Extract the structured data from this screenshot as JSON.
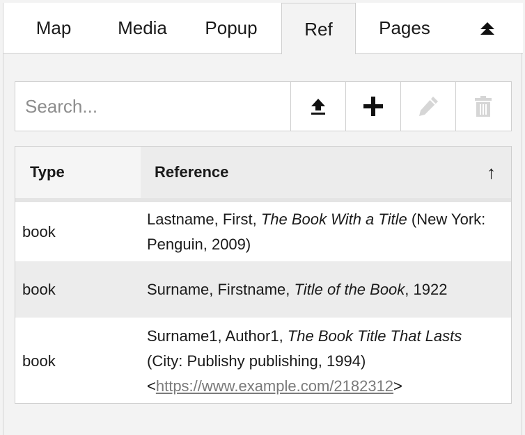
{
  "tabs": [
    {
      "label": "Map"
    },
    {
      "label": "Media"
    },
    {
      "label": "Popup"
    },
    {
      "label": "Ref",
      "active": true
    },
    {
      "label": "Pages"
    }
  ],
  "collapse_icon": "collapse-up-icon",
  "search": {
    "placeholder": "Search...",
    "value": ""
  },
  "toolbar_buttons": [
    {
      "name": "upload-button",
      "icon": "upload-icon",
      "enabled": true
    },
    {
      "name": "add-button",
      "icon": "plus-icon",
      "enabled": true
    },
    {
      "name": "edit-button",
      "icon": "pencil-icon",
      "enabled": false
    },
    {
      "name": "delete-button",
      "icon": "trash-icon",
      "enabled": false
    }
  ],
  "table": {
    "columns": {
      "type": "Type",
      "reference": "Reference",
      "sort_indicator": "↑"
    },
    "rows": [
      {
        "type": "book",
        "ref_before": "Lastname, First, ",
        "ref_title": "The Book With a Title",
        "ref_after": " (New York: Penguin, 2009)",
        "ref_link_prefix": "",
        "ref_link": "",
        "ref_link_suffix": ""
      },
      {
        "type": "book",
        "ref_before": "Surname, Firstname, ",
        "ref_title": "Title of the Book",
        "ref_after": ", 1922",
        "ref_link_prefix": "",
        "ref_link": "",
        "ref_link_suffix": ""
      },
      {
        "type": "book",
        "ref_before": "Surname1, Author1, ",
        "ref_title": "The Book Title That Lasts",
        "ref_after": " (City: Publishy publishing, 1994)",
        "ref_link_prefix": "<",
        "ref_link": "https://www.example.com/2182312",
        "ref_link_suffix": ">"
      }
    ]
  },
  "colors": {
    "panel_bg": "#f3f3f3",
    "alt_row": "#ececec",
    "disabled_icon": "#d6d6d6",
    "link": "#7a7a7a"
  }
}
